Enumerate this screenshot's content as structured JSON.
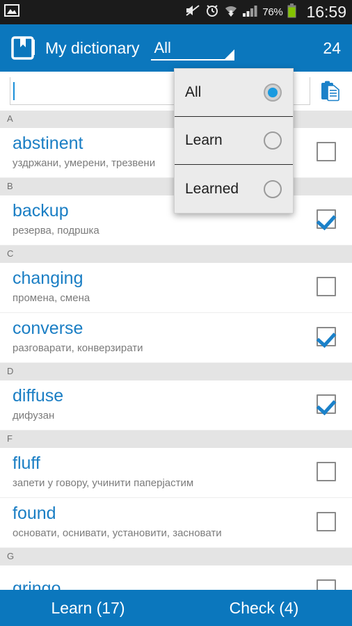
{
  "statusbar": {
    "time": "16:59",
    "battery_pct": "76%",
    "icons": [
      "image-icon",
      "mute-icon",
      "alarm-icon",
      "wifi-icon",
      "signal-icon",
      "battery-icon"
    ]
  },
  "actionbar": {
    "logo": "book-bookmark-icon",
    "title": "My dictionary",
    "filter_label": "All",
    "count": "24"
  },
  "search": {
    "value": "",
    "placeholder": "",
    "paste_icon": "clipboard-paste-icon"
  },
  "dropdown": {
    "open": true,
    "items": [
      {
        "label": "All",
        "selected": true
      },
      {
        "label": "Learn",
        "selected": false
      },
      {
        "label": "Learned",
        "selected": false
      }
    ]
  },
  "list": [
    {
      "type": "header",
      "letter": "A"
    },
    {
      "type": "word",
      "word": "abstinent",
      "translation": "уздржани, умерени, трезвени",
      "checked": false
    },
    {
      "type": "header",
      "letter": "B"
    },
    {
      "type": "word",
      "word": "backup",
      "translation": "резерва, подршка",
      "checked": true
    },
    {
      "type": "header",
      "letter": "C"
    },
    {
      "type": "word",
      "word": "changing",
      "translation": "промена, смена",
      "checked": false
    },
    {
      "type": "word",
      "word": "converse",
      "translation": "разговарати, конверзирати",
      "checked": true
    },
    {
      "type": "header",
      "letter": "D"
    },
    {
      "type": "word",
      "word": "diffuse",
      "translation": "дифузан",
      "checked": true
    },
    {
      "type": "header",
      "letter": "F"
    },
    {
      "type": "word",
      "word": "fluff",
      "translation": "запети у говору, учинити паперјастим",
      "checked": false
    },
    {
      "type": "word",
      "word": "found",
      "translation": "основати, оснивати, установити, засновати",
      "checked": false
    },
    {
      "type": "header",
      "letter": "G"
    },
    {
      "type": "word",
      "word": "gringo",
      "translation": "",
      "checked": false
    }
  ],
  "bottombar": {
    "learn_label": "Learn (17)",
    "check_label": "Check (4)"
  },
  "colors": {
    "accent": "#0b77bd",
    "word": "#1a7ec4",
    "statusbar": "#1b1b1b",
    "section_bg": "#e4e4e4",
    "dropdown_bg": "#ebebeb"
  }
}
